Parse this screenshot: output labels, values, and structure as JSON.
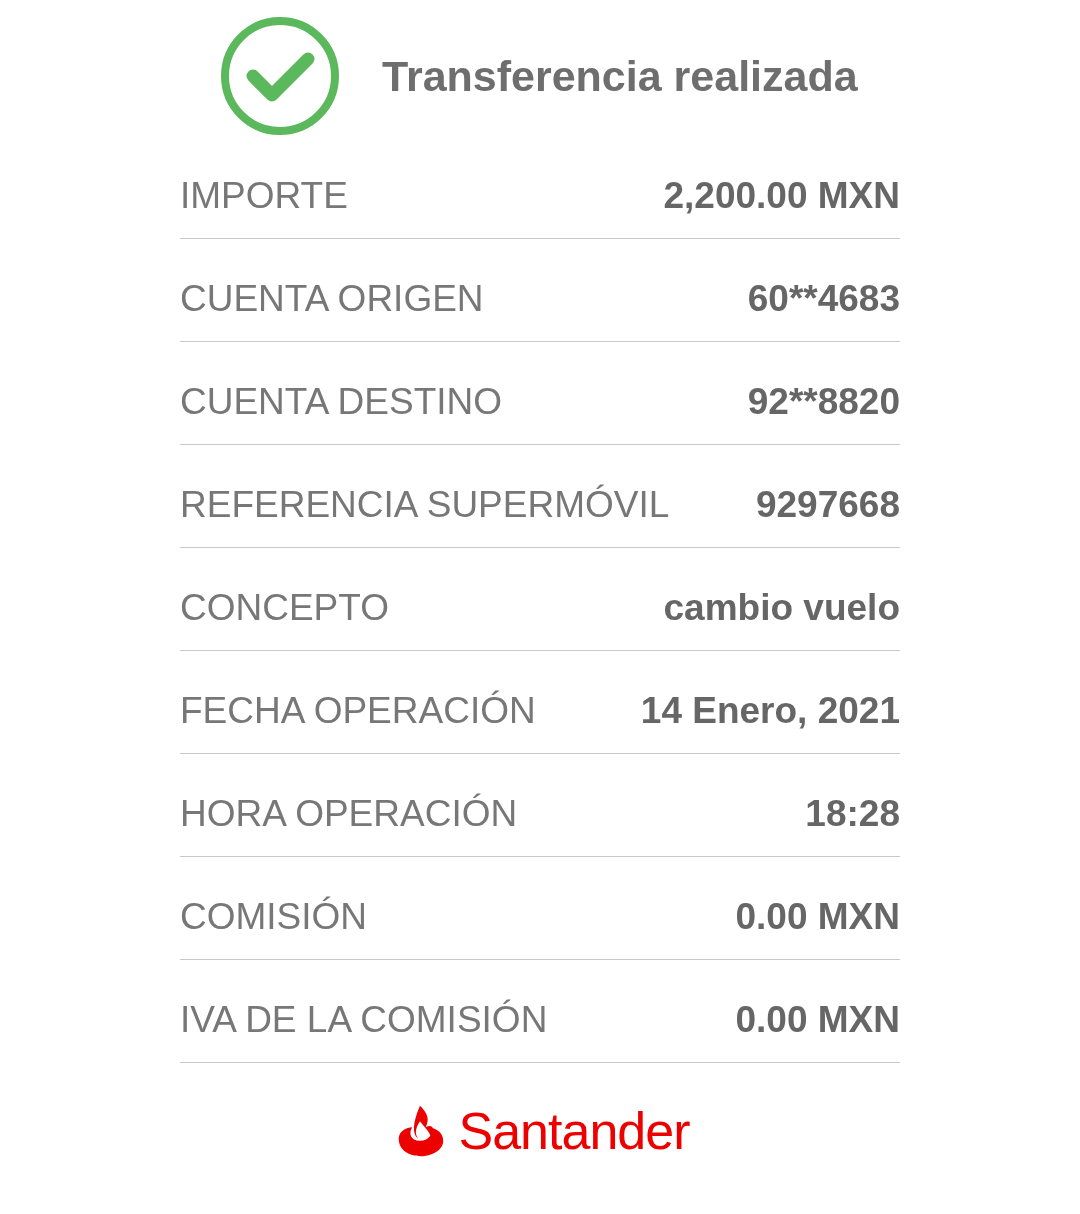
{
  "header": {
    "title": "Transferencia realizada"
  },
  "rows": [
    {
      "label": "IMPORTE",
      "value": "2,200.00 MXN"
    },
    {
      "label": "CUENTA ORIGEN",
      "value": "60**4683"
    },
    {
      "label": "CUENTA DESTINO",
      "value": "92**8820"
    },
    {
      "label": "REFERENCIA SUPERMÓVIL",
      "value": "9297668"
    },
    {
      "label": "CONCEPTO",
      "value": "cambio vuelo"
    },
    {
      "label": "FECHA OPERACIÓN",
      "value": "14 Enero, 2021"
    },
    {
      "label": "HORA OPERACIÓN",
      "value": "18:28"
    },
    {
      "label": "COMISIÓN",
      "value": "0.00 MXN"
    },
    {
      "label": "IVA DE LA COMISIÓN",
      "value": "0.00 MXN"
    }
  ],
  "footer": {
    "brand": "Santander"
  }
}
